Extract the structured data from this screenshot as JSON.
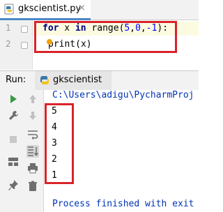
{
  "editor_tab": {
    "filename": "gkscientist.py",
    "close_glyph": "×",
    "icon": "python-file-icon"
  },
  "editor": {
    "lines": [
      {
        "number": "1",
        "keyword": "for",
        "text_a": " x ",
        "keyword2": "in",
        "text_b": " range(",
        "n1": "5",
        "c1": ",",
        "n2": "0",
        "c2": ",",
        "n3": "-1",
        "text_c": "):"
      },
      {
        "number": "2",
        "text": "print(x)"
      }
    ]
  },
  "run_panel": {
    "label": "Run:",
    "tab_name": "gkscientist",
    "console": {
      "command": "C:\\Users\\adigu\\PycharmProj",
      "output": [
        "5",
        "4",
        "3",
        "2",
        "1"
      ],
      "finish_message": "Process finished with exit"
    },
    "tools": [
      "run-icon",
      "up-arrow-icon",
      "wrench-icon",
      "down-arrow-icon",
      "stop-icon",
      "soft-wrap-icon",
      "scroll-to-end-icon",
      "layout-icon",
      "print-icon",
      "pin-icon",
      "trash-icon"
    ]
  },
  "colors": {
    "highlight_box": "#d9232a",
    "keyword": "#000080",
    "number": "#0000ff",
    "console_blue": "#0033b3",
    "run_green": "#3a9a45"
  }
}
